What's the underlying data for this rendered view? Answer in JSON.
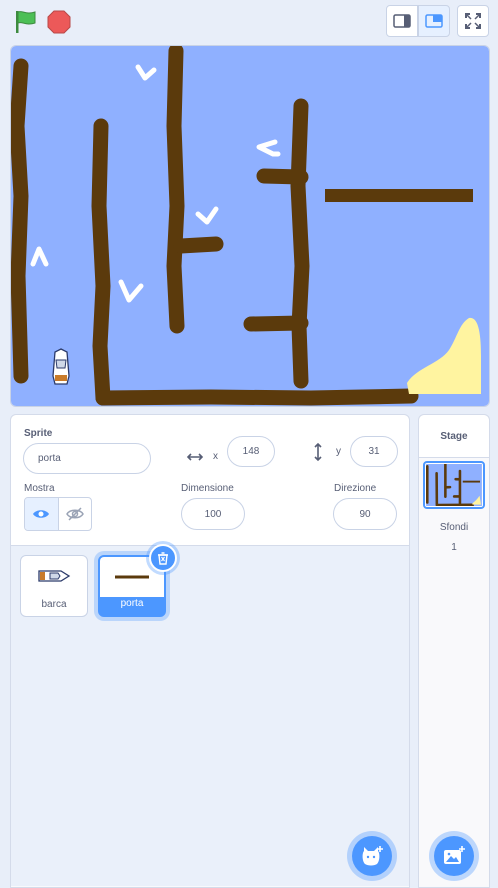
{
  "topbar": {
    "green_flag_icon": "green-flag-icon",
    "stop_icon": "stop-icon",
    "small_stage_icon": "small-stage-icon",
    "large_stage_icon": "large-stage-icon",
    "fullscreen_icon": "fullscreen-icon"
  },
  "sprite_info": {
    "sprite_label": "Sprite",
    "sprite_name": "porta",
    "x_label": "x",
    "x_value": "148",
    "y_label": "y",
    "y_value": "31",
    "show_label": "Mostra",
    "size_label": "Dimensione",
    "size_value": "100",
    "direction_label": "Direzione",
    "direction_value": "90"
  },
  "sprites": [
    {
      "name": "barca",
      "selected": false
    },
    {
      "name": "porta",
      "selected": true
    }
  ],
  "stage_panel": {
    "title": "Stage",
    "backdrops_label": "Sfondi",
    "backdrops_count": "1"
  },
  "colors": {
    "accent": "#4c97ff",
    "water": "#8fb0ff",
    "wall": "#5b3a0c",
    "sand": "#fff4a0",
    "flag": "#4cbf56",
    "stop": "#ec5959"
  }
}
